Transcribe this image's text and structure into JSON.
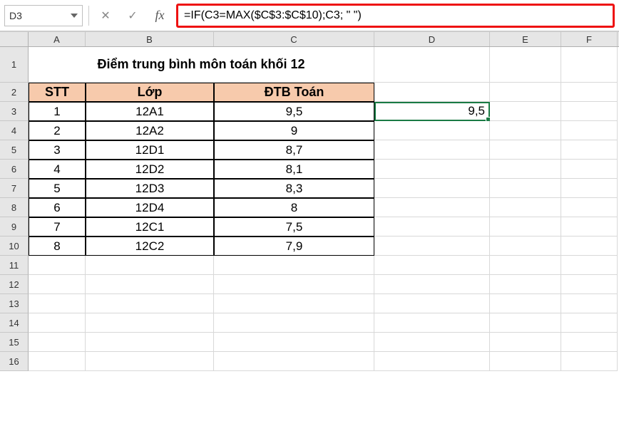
{
  "formula_bar": {
    "cell_ref": "D3",
    "fx_label": "fx",
    "formula": "=IF(C3=MAX($C$3:$C$10);C3; \"  \")"
  },
  "columns": [
    "",
    "A",
    "B",
    "C",
    "D",
    "E",
    "F"
  ],
  "rows": [
    "1",
    "2",
    "3",
    "4",
    "5",
    "6",
    "7",
    "8",
    "9",
    "10",
    "11",
    "12",
    "13",
    "14",
    "15",
    "16"
  ],
  "title": "Điểm trung bình môn toán khối 12",
  "table": {
    "headers": {
      "stt": "STT",
      "lop": "Lớp",
      "dtb": "ĐTB Toán"
    },
    "data": [
      {
        "stt": "1",
        "lop": "12A1",
        "dtb": "9,5"
      },
      {
        "stt": "2",
        "lop": "12A2",
        "dtb": "9"
      },
      {
        "stt": "3",
        "lop": "12D1",
        "dtb": "8,7"
      },
      {
        "stt": "4",
        "lop": "12D2",
        "dtb": "8,1"
      },
      {
        "stt": "5",
        "lop": "12D3",
        "dtb": "8,3"
      },
      {
        "stt": "6",
        "lop": "12D4",
        "dtb": "8"
      },
      {
        "stt": "7",
        "lop": "12C1",
        "dtb": "7,5"
      },
      {
        "stt": "8",
        "lop": "12C2",
        "dtb": "7,9"
      }
    ]
  },
  "selected_value": "9,5"
}
